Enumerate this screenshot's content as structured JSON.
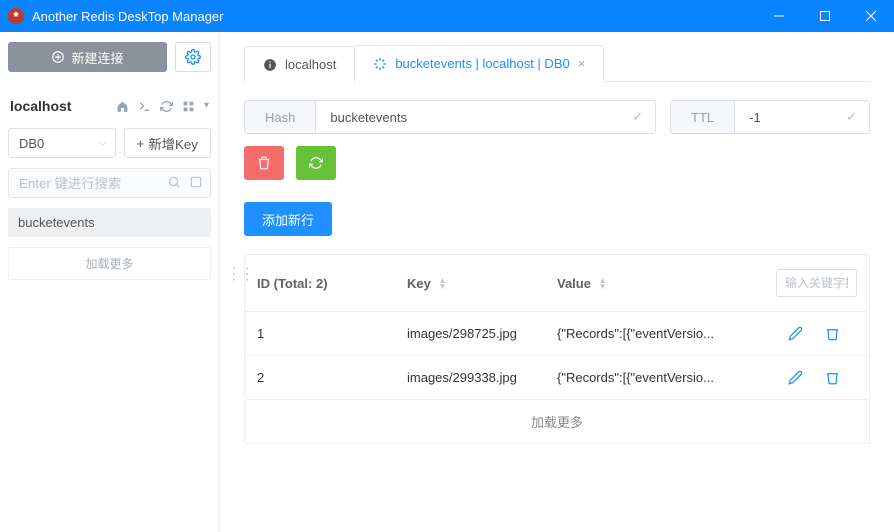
{
  "app": {
    "title": "Another Redis DeskTop Manager"
  },
  "sidebar": {
    "new_connection_label": "新建连接",
    "server_name": "localhost",
    "db_selected": "DB0",
    "add_key_label": "新增Key",
    "search_placeholder": "Enter 键进行搜索",
    "keys": [
      {
        "name": "bucketevents"
      }
    ],
    "load_more_label": "加载更多"
  },
  "tabs": [
    {
      "label": "localhost",
      "icon": "info",
      "active": false,
      "closable": false
    },
    {
      "label": "bucketevents | localhost | DB0",
      "icon": "spinner",
      "active": true,
      "closable": true
    }
  ],
  "detail": {
    "type_label": "Hash",
    "key_name": "bucketevents",
    "ttl_label": "TTL",
    "ttl_value": "-1",
    "add_row_label": "添加新行",
    "table": {
      "id_header": "ID (Total: 2)",
      "key_header": "Key",
      "value_header": "Value",
      "filter_placeholder": "输入关键字搜",
      "rows": [
        {
          "id": "1",
          "key": "images/298725.jpg",
          "value": "{\"Records\":[{\"eventVersio..."
        },
        {
          "id": "2",
          "key": "images/299338.jpg",
          "value": "{\"Records\":[{\"eventVersio..."
        }
      ],
      "load_more_label": "加载更多"
    }
  }
}
